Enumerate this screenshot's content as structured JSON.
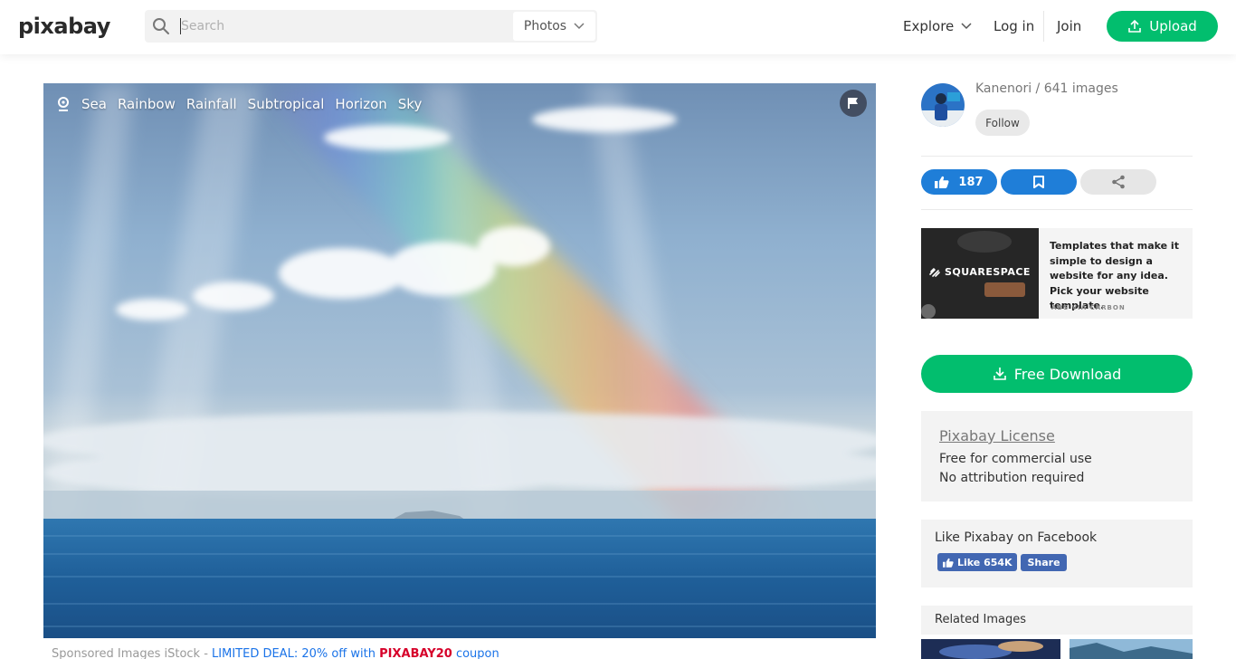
{
  "header": {
    "logo": "pixabay",
    "search_placeholder": "Search",
    "search_type": "Photos",
    "nav_explore": "Explore",
    "nav_login": "Log in",
    "nav_join": "Join",
    "upload_label": "Upload"
  },
  "photo": {
    "tags": [
      "Sea",
      "Rainbow",
      "Rainfall",
      "Subtropical",
      "Horizon",
      "Sky"
    ]
  },
  "sponsored": {
    "prefix": "Sponsored Images iStock - ",
    "deal": "LIMITED DEAL: 20% off with ",
    "code": "PIXABAY20",
    "suffix": " coupon"
  },
  "author": {
    "line": "Kanenori / 641 images",
    "follow_label": "Follow"
  },
  "actions": {
    "likes": "187"
  },
  "ad": {
    "brand": "SQUARESPACE",
    "text": "Templates that make it simple to design a website for any idea. Pick your website template.",
    "via": "ADS VIA CARBON"
  },
  "download": {
    "label": "Free Download"
  },
  "license": {
    "title": "Pixabay License",
    "line1": "Free for commercial use",
    "line2": "No attribution required"
  },
  "facebook": {
    "title": "Like Pixabay on Facebook",
    "like_label": "Like 654K",
    "share_label": "Share"
  },
  "related": {
    "title": "Related Images"
  },
  "colors": {
    "accent_green": "#02be6e",
    "action_blue": "#1f7ed8",
    "facebook_blue": "#4267b2",
    "coupon_red": "#d6002a"
  }
}
